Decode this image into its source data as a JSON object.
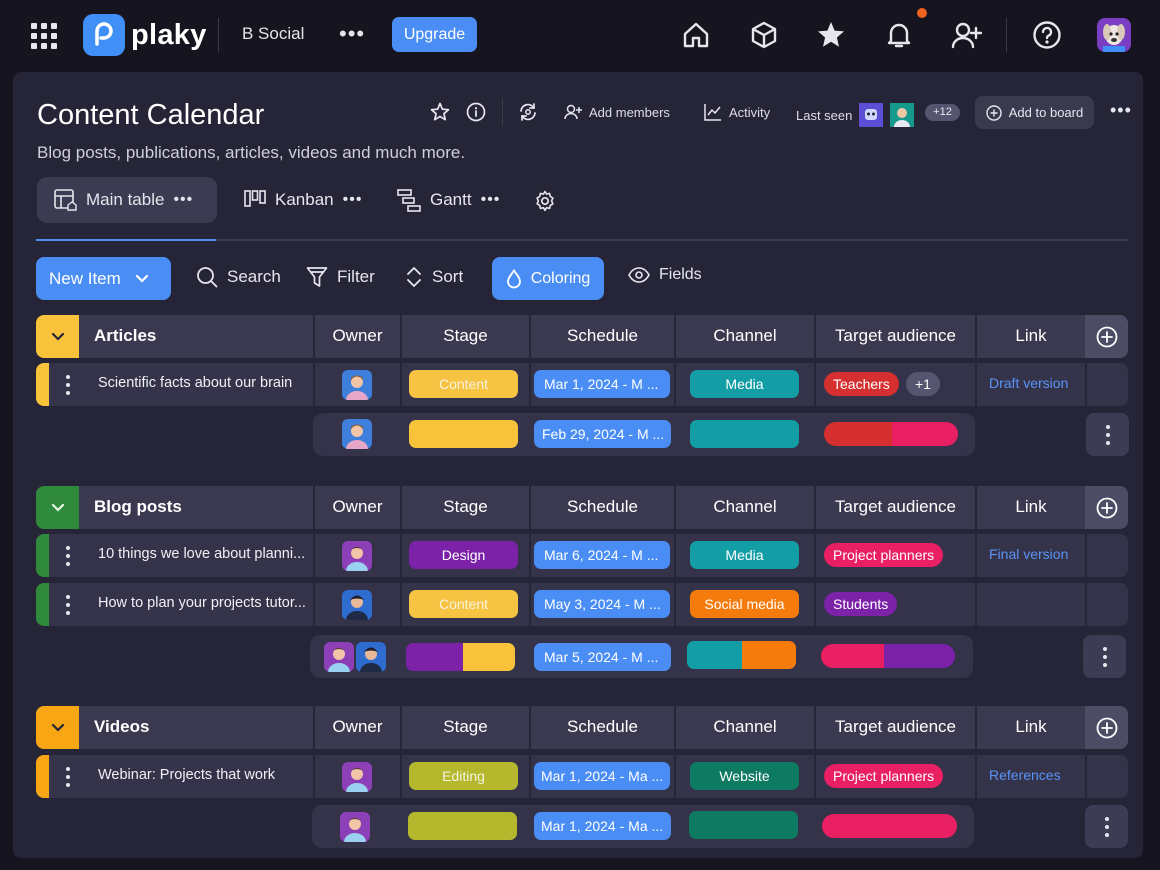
{
  "app": {
    "logo_text": "plaky",
    "workspace": "B Social",
    "upgrade_label": "Upgrade"
  },
  "board": {
    "title": "Content Calendar",
    "subtitle": "Blog posts, publications, articles, videos and much more.",
    "add_members": "Add members",
    "activity": "Activity",
    "last_seen": "Last seen",
    "extra_viewers": "+12",
    "add_to_board": "Add to board"
  },
  "views": [
    {
      "label": "Main table",
      "active": true
    },
    {
      "label": "Kanban",
      "active": false
    },
    {
      "label": "Gantt",
      "active": false
    }
  ],
  "toolbar": {
    "new_item": "New Item",
    "search": "Search",
    "filter": "Filter",
    "sort": "Sort",
    "coloring": "Coloring",
    "fields": "Fields"
  },
  "columns": [
    "Owner",
    "Stage",
    "Schedule",
    "Channel",
    "Target audience",
    "Link"
  ],
  "colors": {
    "accent": "#4a8ef5",
    "articles": "#f8c23a",
    "blog_posts": "#2f8a3b",
    "videos": "#f9a614",
    "content": "#f6c342",
    "design": "#7b22a8",
    "editing": "#b5b82c",
    "media": "#139ea6",
    "social_media": "#f57c0c",
    "website": "#0e7a62",
    "teachers": "#d5302f",
    "project_planners": "#e91f63",
    "students": "#7b22a8"
  },
  "groups": [
    {
      "name": "Articles",
      "items": [
        {
          "name": "Scientific facts about our brain",
          "stage": "Content",
          "schedule": "Mar 1, 2024 - M ...",
          "channel": "Media",
          "audience": "Teachers",
          "audience_extra": "+1",
          "link": "Draft version"
        }
      ],
      "summary_schedule": "Feb 29, 2024 - M ..."
    },
    {
      "name": "Blog posts",
      "items": [
        {
          "name": "10 things we love about planni...",
          "stage": "Design",
          "schedule": "Mar 6, 2024 - M ...",
          "channel": "Media",
          "audience": "Project planners",
          "link": "Final version"
        },
        {
          "name": "How to plan your projects tutor...",
          "stage": "Content",
          "schedule": "May 3, 2024 - M ...",
          "channel": "Social media",
          "audience": "Students",
          "link": ""
        }
      ],
      "summary_schedule": "Mar 5, 2024 - M ..."
    },
    {
      "name": "Videos",
      "items": [
        {
          "name": "Webinar: Projects that work",
          "stage": "Editing",
          "schedule": "Mar 1, 2024 - Ma ...",
          "channel": "Website",
          "audience": "Project planners",
          "link": "References"
        }
      ],
      "summary_schedule": "Mar 1, 2024 - Ma ..."
    }
  ]
}
